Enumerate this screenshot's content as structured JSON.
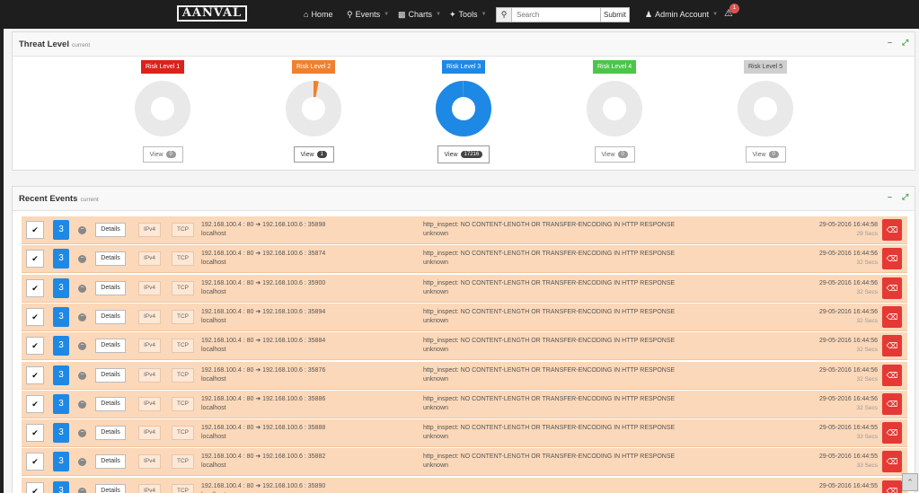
{
  "app": {
    "logo": "AANVAL"
  },
  "nav": {
    "home": "Home",
    "events": "Events",
    "charts": "Charts",
    "tools": "Tools",
    "search_placeholder": "Search",
    "submit": "Submit",
    "account": "Admin Account",
    "alert_count": "1"
  },
  "threat": {
    "title": "Threat Level",
    "subtitle": "current",
    "levels": [
      {
        "label": "Risk Level 1",
        "color": "#d9231b",
        "count": "0",
        "fraction": 0
      },
      {
        "label": "Risk Level 2",
        "color": "#f0802e",
        "count": "1",
        "fraction": 0.03
      },
      {
        "label": "Risk Level 3",
        "color": "#1e88e5",
        "count": "17216",
        "fraction": 0.997
      },
      {
        "label": "Risk Level 4",
        "color": "#4cc54a",
        "count": "0",
        "fraction": 0
      },
      {
        "label": "Risk Level 5",
        "color": "#cfcfcf",
        "count": "0",
        "fraction": 0
      }
    ],
    "view_label": "View"
  },
  "events": {
    "title": "Recent Events",
    "subtitle": "current",
    "details_label": "Details",
    "ipv4_label": "IPv4",
    "tcp_label": "TCP",
    "rows": [
      {
        "sev": "3",
        "src": "192.168.100.4 : 80",
        "dst": "192.168.100.6 : 35898",
        "host": "localhost",
        "msg": "http_inspect: NO CONTENT-LENGTH OR TRANSFER-ENCODING IN HTTP RESPONSE",
        "sig": "unknown",
        "time": "29-05-2016 16:44:58",
        "ago": "29 Secs"
      },
      {
        "sev": "3",
        "src": "192.168.100.4 : 80",
        "dst": "192.168.100.6 : 35874",
        "host": "localhost",
        "msg": "http_inspect: NO CONTENT-LENGTH OR TRANSFER-ENCODING IN HTTP RESPONSE",
        "sig": "unknown",
        "time": "29-05-2016 16:44:56",
        "ago": "32 Secs"
      },
      {
        "sev": "3",
        "src": "192.168.100.4 : 80",
        "dst": "192.168.100.6 : 35900",
        "host": "localhost",
        "msg": "http_inspect: NO CONTENT-LENGTH OR TRANSFER-ENCODING IN HTTP RESPONSE",
        "sig": "unknown",
        "time": "29-05-2016 16:44:56",
        "ago": "32 Secs"
      },
      {
        "sev": "3",
        "src": "192.168.100.4 : 80",
        "dst": "192.168.100.6 : 35894",
        "host": "localhost",
        "msg": "http_inspect: NO CONTENT-LENGTH OR TRANSFER-ENCODING IN HTTP RESPONSE",
        "sig": "unknown",
        "time": "29-05-2016 16:44:56",
        "ago": "32 Secs"
      },
      {
        "sev": "3",
        "src": "192.168.100.4 : 80",
        "dst": "192.168.100.6 : 35884",
        "host": "localhost",
        "msg": "http_inspect: NO CONTENT-LENGTH OR TRANSFER-ENCODING IN HTTP RESPONSE",
        "sig": "unknown",
        "time": "29-05-2016 16:44:56",
        "ago": "32 Secs"
      },
      {
        "sev": "3",
        "src": "192.168.100.4 : 80",
        "dst": "192.168.100.6 : 35876",
        "host": "localhost",
        "msg": "http_inspect: NO CONTENT-LENGTH OR TRANSFER-ENCODING IN HTTP RESPONSE",
        "sig": "unknown",
        "time": "29-05-2016 16:44:56",
        "ago": "32 Secs"
      },
      {
        "sev": "3",
        "src": "192.168.100.4 : 80",
        "dst": "192.168.100.6 : 35886",
        "host": "localhost",
        "msg": "http_inspect: NO CONTENT-LENGTH OR TRANSFER-ENCODING IN HTTP RESPONSE",
        "sig": "unknown",
        "time": "29-05-2016 16:44:56",
        "ago": "32 Secs"
      },
      {
        "sev": "3",
        "src": "192.168.100.4 : 80",
        "dst": "192.168.100.6 : 35888",
        "host": "localhost",
        "msg": "http_inspect: NO CONTENT-LENGTH OR TRANSFER-ENCODING IN HTTP RESPONSE",
        "sig": "unknown",
        "time": "29-05-2016 16:44:55",
        "ago": "33 Secs"
      },
      {
        "sev": "3",
        "src": "192.168.100.4 : 80",
        "dst": "192.168.100.6 : 35882",
        "host": "localhost",
        "msg": "http_inspect: NO CONTENT-LENGTH OR TRANSFER-ENCODING IN HTTP RESPONSE",
        "sig": "unknown",
        "time": "29-05-2016 16:44:55",
        "ago": "33 Secs"
      },
      {
        "sev": "3",
        "src": "192.168.100.4 : 80",
        "dst": "192.168.100.6 : 35890",
        "host": "localhost",
        "msg": "",
        "sig": "",
        "time": "29-05-2016 16:44:55",
        "ago": ""
      }
    ]
  }
}
